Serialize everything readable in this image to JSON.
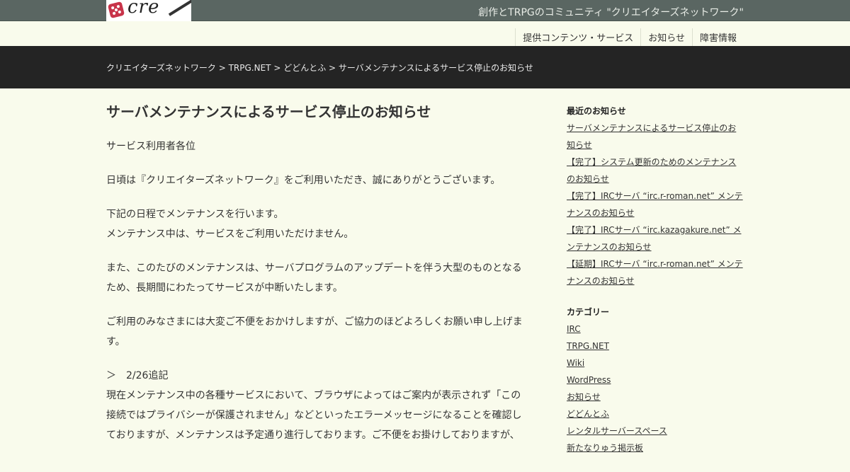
{
  "header": {
    "logo_text": "cre",
    "tagline": "創作とTRPGのコミュニティ \"クリエイターズネットワーク\""
  },
  "nav": [
    "提供コンテンツ・サービス",
    "お知らせ",
    "障害情報"
  ],
  "breadcrumb": "クリエイターズネットワーク > TRPG.NET > どどんとふ > サーバメンテナンスによるサービス停止のお知らせ",
  "article": {
    "title": "サーバメンテナンスによるサービス停止のお知らせ",
    "p1": "サービス利用者各位",
    "p2": "日頃は『クリエイターズネットワーク』をご利用いただき、誠にありがとうございます。",
    "p3a": "下記の日程でメンテナンスを行います。",
    "p3b": "メンテナンス中は、サービスをご利用いただけません。",
    "p4": "また、このたびのメンテナンスは、サーバプログラムのアップデートを伴う大型のものとなるため、長期間にわたってサービスが中断いたします。",
    "p5": "ご利用のみなさまには大変ご不便をおかけしますが、ご協力のほどよろしくお願い申し上げます。",
    "p6a": "＞　2/26追記",
    "p6b": "現在メンテナンス中の各種サービスにおいて、ブラウザによってはご案内が表示されず「この接続ではプライバシーが保護されません」などといったエラーメッセージになることを確認しておりますが、メンテナンスは予定通り進行しております。ご不便をお掛けしておりますが、"
  },
  "sidebar": {
    "recent_title": "最近のお知らせ",
    "recent": [
      "サーバメンテナンスによるサービス停止のお知らせ",
      "【完了】システム更新のためのメンテナンスのお知らせ",
      "【完了】IRCサーバ “irc.r-roman.net” メンテナンスのお知らせ",
      "【完了】IRCサーバ “irc.kazagakure.net” メンテナンスのお知らせ",
      "【延期】IRCサーバ “irc.r-roman.net” メンテナンスのお知らせ"
    ],
    "category_title": "カテゴリー",
    "categories": [
      "IRC",
      "TRPG.NET",
      "Wiki",
      "WordPress",
      "お知らせ",
      "どどんとふ",
      "レンタルサーバースペース",
      "新たなりゅう掲示板"
    ]
  }
}
